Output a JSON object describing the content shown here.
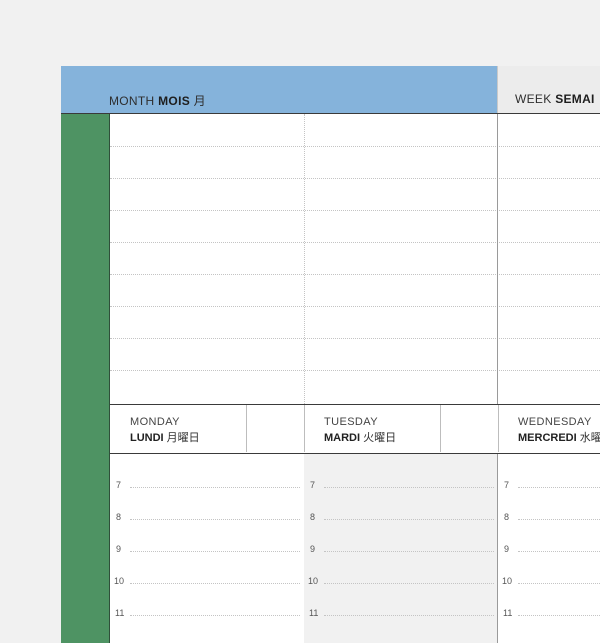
{
  "header": {
    "month": {
      "en": "MONTH",
      "fr": "MOIS",
      "jp": "月"
    },
    "week": {
      "en": "WEEK",
      "fr": "SEMAI"
    }
  },
  "days": [
    {
      "en": "MONDAY",
      "fr": "LUNDI",
      "jp": "月曜日"
    },
    {
      "en": "TUESDAY",
      "fr": "MARDI",
      "jp": "火曜日"
    },
    {
      "en": "WEDNESDAY",
      "fr": "MERCREDI",
      "jp": "水曜"
    }
  ],
  "hours": [
    "7",
    "8",
    "9",
    "10",
    "11"
  ],
  "colors": {
    "month_header": "#85b3db",
    "sidebar": "#4e9363",
    "background": "#f1f1f1",
    "tuesday_shade": "#f1f1f1"
  }
}
